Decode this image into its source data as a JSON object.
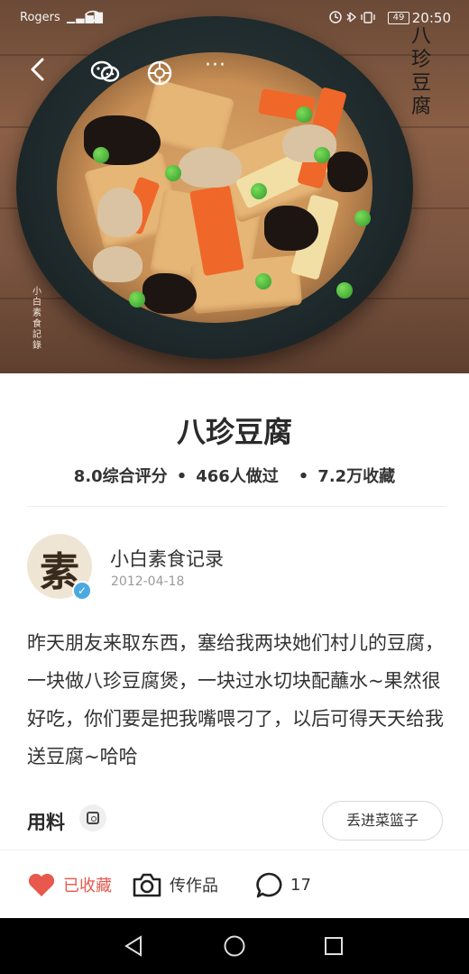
{
  "status_bar": {
    "carrier": "Rogers",
    "battery": "49",
    "time": "20:50"
  },
  "hero": {
    "overlay_title": "八珍豆腐",
    "stamp": "小白素食記錄",
    "icons": [
      "back-icon",
      "wechat-icon",
      "moments-icon",
      "more-icon"
    ]
  },
  "recipe": {
    "title": "八珍豆腐",
    "rating": "8.0综合评分",
    "cooked": "466人做过",
    "favorites": "7.2万收藏"
  },
  "author": {
    "avatar_char": "素",
    "name": "小白素食记录",
    "date": "2012-04-18"
  },
  "description": "昨天朋友来取东西，塞给我两块她们村儿的豆腐，一块做八珍豆腐煲，一块过水切块配蘸水~果然很好吃，你们要是把我嘴喂刁了，以后可得天天给我送豆腐~哈哈",
  "ingredients": {
    "label": "用料",
    "basket_button": "丢进菜篮子"
  },
  "action_bar": {
    "favorited_label": "已收藏",
    "upload_label": "传作品",
    "comment_count": "17"
  },
  "colors": {
    "accent": "#e8584c",
    "verify": "#4aa9e0"
  }
}
